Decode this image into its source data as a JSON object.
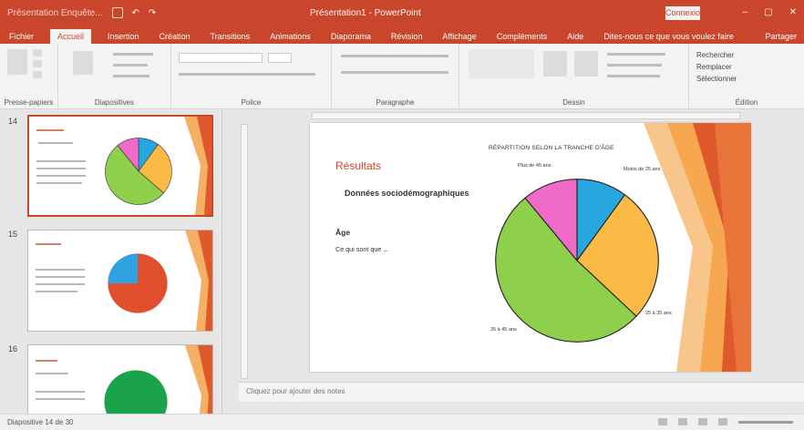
{
  "titlebar": {
    "document_name": "Présentation Enquête...",
    "app_title": "Présentation1 - PowerPoint",
    "signin_label": "Connexion",
    "minimize": "–",
    "restore": "▢",
    "close": "✕"
  },
  "ribbon": {
    "tabs": [
      "Fichier",
      "Accueil",
      "Insertion",
      "Création",
      "Transitions",
      "Animations",
      "Diaporama",
      "Révision",
      "Affichage",
      "Compléments",
      "Aide",
      "Dites-nous ce que vous voulez faire"
    ],
    "active_tab": 1,
    "share_label": "Partager",
    "groups": {
      "clipboard": "Presse-papiers",
      "slides": "Diapositives",
      "font": "Police",
      "paragraph": "Paragraphe",
      "drawing": "Dessin",
      "editing": "Édition"
    },
    "editing_buttons": [
      "Rechercher",
      "Remplacer",
      "Sélectionner"
    ]
  },
  "thumbnails": [
    {
      "number": "14",
      "selected": true
    },
    {
      "number": "15",
      "selected": false
    },
    {
      "number": "16",
      "selected": false
    }
  ],
  "slide": {
    "title": "Résultats",
    "subtitle": "Données sociodémographiques",
    "section": "Âge",
    "body": "Ce qui sont que ...",
    "chart_title": "RÉPARTITION SELON LA TRANCHE D'ÂGE"
  },
  "chart_data": {
    "type": "pie",
    "title": "RÉPARTITION SELON LA TRANCHE D'ÂGE",
    "slices": [
      {
        "label": "Moins de 25 ans",
        "value": 10,
        "color": "#27a7e0"
      },
      {
        "label": "25 à 35 ans",
        "value": 27,
        "color": "#fbb945"
      },
      {
        "label": "35 à 45 ans",
        "value": 52,
        "color": "#8ecf4c"
      },
      {
        "label": "Plus de 45 ans",
        "value": 11,
        "color": "#f06bc8"
      }
    ]
  },
  "notes": {
    "placeholder": "Cliquez pour ajouter des notes"
  },
  "statusbar": {
    "text": "Diapositive 14 de 30"
  },
  "colors": {
    "accent": "#c9462c",
    "deco_dark": "#de5a2d",
    "deco_light": "#f6b063"
  }
}
